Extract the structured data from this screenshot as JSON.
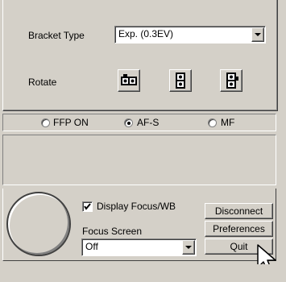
{
  "bracket": {
    "label": "Bracket Type",
    "value": "Exp. (0.3EV)"
  },
  "rotate": {
    "label": "Rotate"
  },
  "focus_mode": {
    "options": [
      "FFP ON",
      "AF-S",
      "MF"
    ],
    "selected": "AF-S"
  },
  "display_focus_wb": {
    "label": "Display Focus/WB",
    "checked": true
  },
  "focus_screen": {
    "label": "Focus Screen",
    "value": "Off"
  },
  "buttons": {
    "disconnect": "Disconnect",
    "preferences": "Preferences",
    "quit": "Quit"
  }
}
